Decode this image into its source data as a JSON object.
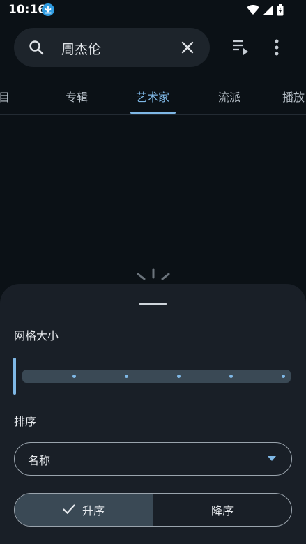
{
  "status_bar": {
    "time": "10:16"
  },
  "search": {
    "query": "周杰伦"
  },
  "tabs": [
    {
      "label": "目"
    },
    {
      "label": "专辑"
    },
    {
      "label": "艺术家"
    },
    {
      "label": "流派"
    },
    {
      "label": "播放"
    }
  ],
  "active_tab": 2,
  "sheet": {
    "grid_label": "网格大小",
    "grid_size_value": 1,
    "sort_label": "排序",
    "sort_field": "名称",
    "order": {
      "ascending": "升序",
      "descending": "降序",
      "selected": "ascending"
    }
  },
  "colors": {
    "accent": "#7fb8e6",
    "background": "#0b1116",
    "sheet": "#191f27"
  }
}
